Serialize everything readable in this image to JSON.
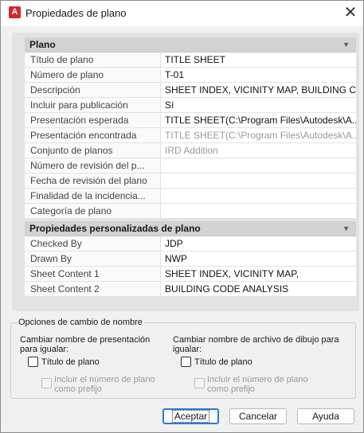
{
  "window": {
    "title": "Propiedades de plano",
    "app_icon_letter": "A"
  },
  "categories": [
    {
      "label": "Plano",
      "rows": [
        {
          "name": "Título de plano",
          "value": "TITLE SHEET",
          "disabled": false
        },
        {
          "name": "Número de plano",
          "value": "T-01",
          "disabled": false
        },
        {
          "name": "Descripción",
          "value": "SHEET INDEX, VICINITY MAP, BUILDING C...",
          "disabled": false
        },
        {
          "name": "Incluir para publicación",
          "value": "Sí",
          "disabled": false
        },
        {
          "name": "Presentación esperada",
          "value": "TITLE SHEET(C:\\Program Files\\Autodesk\\A...",
          "disabled": false
        },
        {
          "name": "Presentación encontrada",
          "value": "TITLE SHEET(C:\\Program Files\\Autodesk\\A...",
          "disabled": true
        },
        {
          "name": "Conjunto de planos",
          "value": "IRD Addition",
          "disabled": true
        },
        {
          "name": "Número de revisión del p...",
          "value": "",
          "disabled": false
        },
        {
          "name": "Fecha de revisión del plano",
          "value": "",
          "disabled": false
        },
        {
          "name": "Finalidad de la incidencia...",
          "value": "",
          "disabled": false
        },
        {
          "name": "Categoría de plano",
          "value": "",
          "disabled": false
        }
      ]
    },
    {
      "label": "Propiedades personalizadas de plano",
      "rows": [
        {
          "name": "Checked By",
          "value": "JDP",
          "disabled": false
        },
        {
          "name": "Drawn By",
          "value": "NWP",
          "disabled": false
        },
        {
          "name": "Sheet Content 1",
          "value": "SHEET INDEX, VICINITY MAP,",
          "disabled": false
        },
        {
          "name": "Sheet Content 2",
          "value": "BUILDING CODE ANALYSIS",
          "disabled": false
        }
      ]
    }
  ],
  "rename": {
    "legend": "Opciones de cambio de nombre",
    "left": {
      "label_line1": "Cambiar nombre de presentación",
      "label_line2": "para igualar:",
      "checkbox": "Título de plano",
      "sub_checkbox_line1": "Incluir el número de plano",
      "sub_checkbox_line2": "como prefijo"
    },
    "right": {
      "label_line1": "Cambiar nombre de archivo de dibujo para",
      "label_line2": "igualar:",
      "checkbox": "Título de plano",
      "sub_checkbox_line1": "Incluir el número de plano",
      "sub_checkbox_line2": "como prefijo"
    }
  },
  "buttons": {
    "ok": "Aceptar",
    "cancel": "Cancelar",
    "help": "Ayuda"
  },
  "colors": {
    "app_icon": "#d8242c",
    "default_button_border": "#2b7bd1"
  }
}
